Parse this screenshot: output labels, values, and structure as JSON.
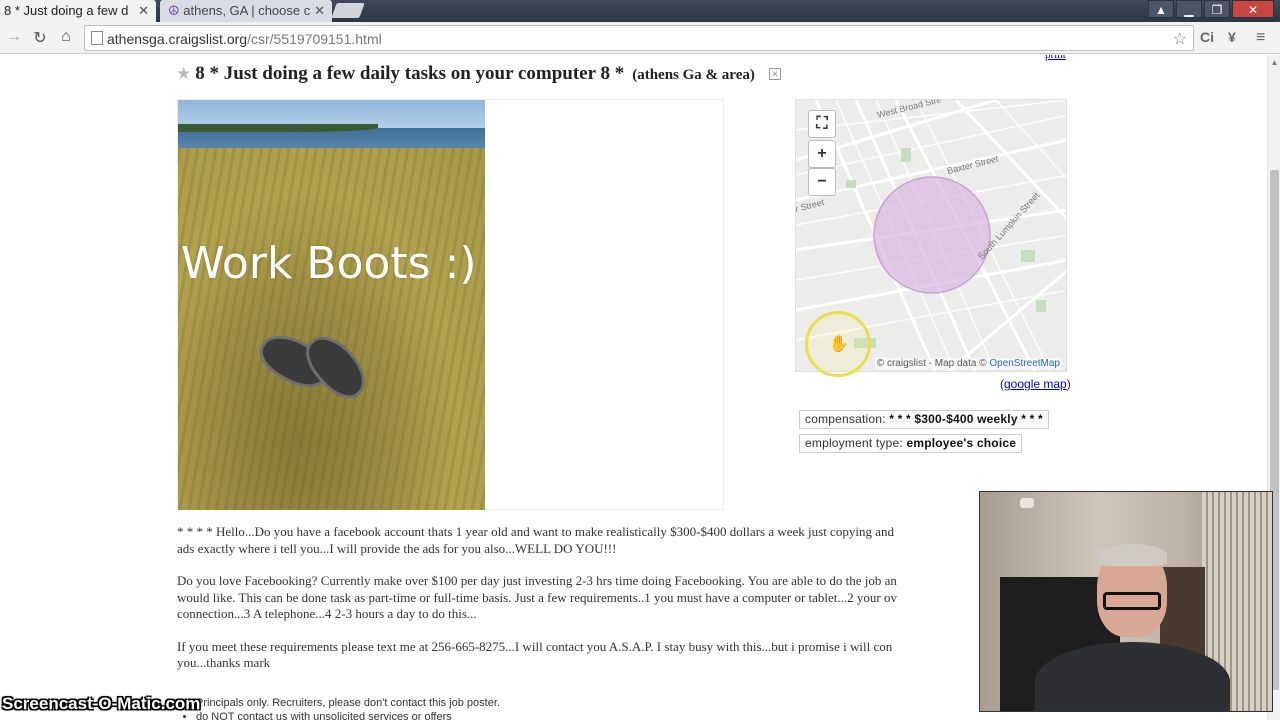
{
  "browser": {
    "tabs": [
      {
        "title": "8 * Just doing a few d",
        "active": true
      },
      {
        "title": "athens, GA | choose c",
        "active": false
      }
    ],
    "url_host": "athensga.craigslist.org",
    "url_path": "/csr/5519709151.html",
    "extensions": [
      "Ci",
      "¥"
    ]
  },
  "posting": {
    "print_label": "print",
    "title": "8 * Just doing a few daily tasks on your computer 8 *",
    "location": "(athens Ga & area)",
    "image_caption": "Work Boots :)",
    "map": {
      "attribution_prefix": "© craigslist - Map data ©",
      "attribution_link": "OpenStreetMap",
      "google_map_label": "google map",
      "street_labels": [
        "West Broad Stre",
        "Baxter Street",
        "South Lumpkin Street",
        "r Street"
      ]
    },
    "attributes": {
      "compensation_label": "compensation:",
      "compensation_value": "* * * $300-$400 weekly * * *",
      "employment_label": "employment type:",
      "employment_value": "employee's choice"
    },
    "body": [
      "* * * * Hello...Do you have a facebook account thats 1 year old and want to make realistically $300-$400 dollars a week just copying and",
      "ads exactly where i tell you...I will provide the ads for you also...WELL DO YOU!!!",
      "Do you love Facebooking? Currently make over $100 per day just investing 2-3 hrs time doing Facebooking. You are able to do the job an",
      "would like. This can be done task as part-time or full-time basis. Just a few requirements..1 you must have a computer or tablet...2 your ov",
      "connection...3 A telephone...4 2-3 hours a day to do this...",
      "If you meet these requirements please text me at 256-665-8275...I will contact you A.S.A.P. I stay busy with this...but i promise i will con",
      "you...thanks mark"
    ],
    "notices": [
      "Principals only. Recruiters, please don't contact this job poster.",
      "do NOT contact us with unsolicited services or offers"
    ]
  },
  "overlay": {
    "watermark": "Screencast-O-Matic.com"
  },
  "colors": {
    "link": "#0000cc",
    "map_circle": "#d9b8e0",
    "cursor_highlight": "#e8e04a"
  }
}
